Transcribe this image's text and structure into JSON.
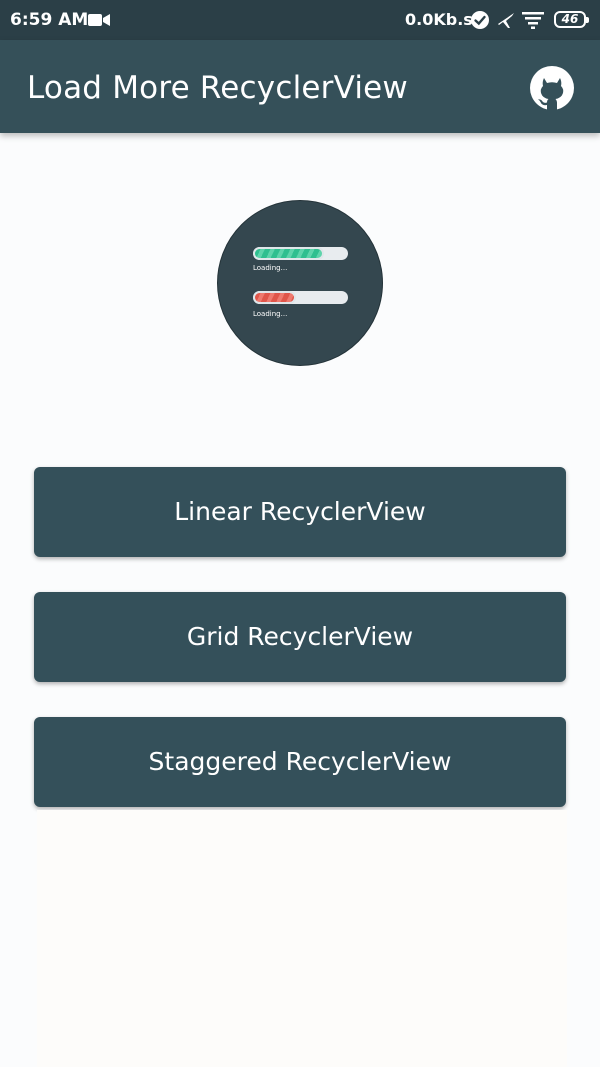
{
  "status_bar": {
    "time": "6:59 AM",
    "network_speed": "0.0Kb.s",
    "battery_level": "46",
    "icons": [
      "video-camera-icon",
      "check-circle-icon",
      "airplane-icon",
      "wifi-icon",
      "battery-icon"
    ]
  },
  "app_bar": {
    "title": "Load More RecyclerView",
    "action_icon": "github-icon"
  },
  "logo": {
    "bars": [
      {
        "caption": "Loading...",
        "color": "#2fbf8f",
        "progress": 0.75
      },
      {
        "caption": "Loading...",
        "color": "#e0564a",
        "progress": 0.45
      }
    ]
  },
  "buttons": {
    "linear": "Linear RecyclerView",
    "grid": "Grid RecyclerView",
    "staggered": "Staggered RecyclerView"
  },
  "colors": {
    "primary": "#355059",
    "status_bar": "#2b3f47",
    "button": "#34505a",
    "background": "#fbfcfd"
  }
}
